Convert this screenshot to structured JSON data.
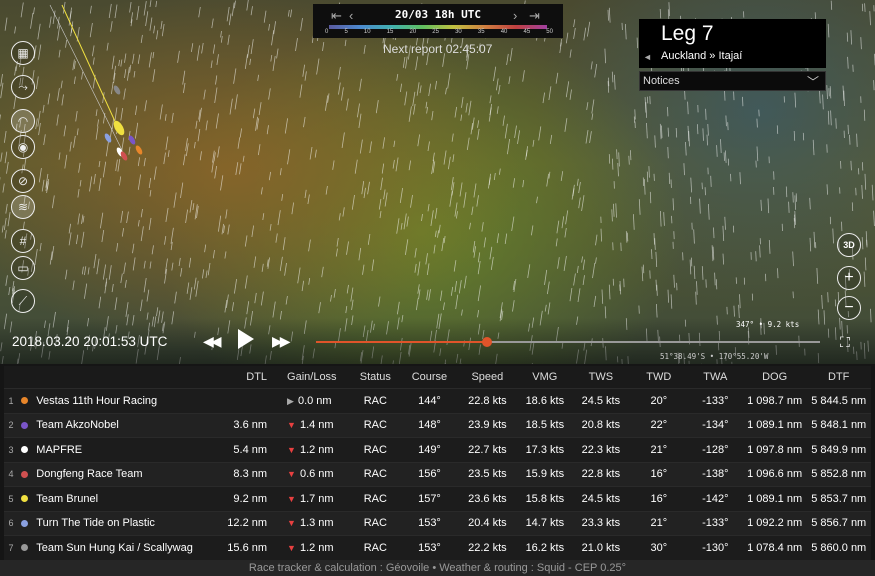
{
  "topbar": {
    "datetime_label": "20/03 18h UTC",
    "prev_icon": "skip-back-icon",
    "next_icon": "skip-forward-icon",
    "scale_ticks": [
      "0",
      "5",
      "10",
      "15",
      "20",
      "25",
      "30",
      "35",
      "40",
      "45",
      "50"
    ]
  },
  "next_report": "Next report 02:45:07",
  "leg": {
    "title": "Leg 7",
    "route": "Auckland » Itajaí"
  },
  "notices": {
    "label": "Notices"
  },
  "tools": [
    {
      "name": "map-icon",
      "glyph": "▦"
    },
    {
      "name": "route-icon",
      "glyph": "⤳"
    },
    {
      "name": "track-icon",
      "glyph": "◠"
    },
    {
      "name": "boat-icon",
      "glyph": "◉"
    },
    {
      "name": "wind-off-icon",
      "glyph": "⊘"
    },
    {
      "name": "wind-icon",
      "glyph": "≋"
    },
    {
      "name": "grid-icon",
      "glyph": "#"
    },
    {
      "name": "ruler-icon",
      "glyph": "▭"
    },
    {
      "name": "chart-icon",
      "glyph": "⟋"
    }
  ],
  "right_controls": {
    "view3d_label": "3D",
    "zoom_in": "+",
    "zoom_out": "−"
  },
  "playback": {
    "datetime": "2018.03.20 20:01:53 UTC",
    "progress": 0.34,
    "wind_info": "347° • 9.2 kts",
    "coordinates": "51°38.49'S • 170°55.20'W"
  },
  "table": {
    "headers": [
      "DTL",
      "Gain/Loss",
      "Status",
      "Course",
      "Speed",
      "VMG",
      "TWS",
      "TWD",
      "TWA",
      "DOG",
      "DTF"
    ],
    "rows": [
      {
        "rank": "1",
        "color": "#e8862a",
        "name": "Vestas 11th Hour Racing",
        "dtl": "",
        "trend": "right",
        "gl": "0.0 nm",
        "status": "RAC",
        "course": "144°",
        "speed": "22.8 kts",
        "vmg": "18.6 kts",
        "tws": "24.5 kts",
        "twd": "20°",
        "twa": "-133°",
        "dog": "1 098.7 nm",
        "dtf": "5 844.5 nm"
      },
      {
        "rank": "2",
        "color": "#7a55c8",
        "name": "Team AkzoNobel",
        "dtl": "3.6 nm",
        "trend": "down",
        "gl": "1.4 nm",
        "status": "RAC",
        "course": "148°",
        "speed": "23.9 kts",
        "vmg": "18.5 kts",
        "tws": "20.8 kts",
        "twd": "22°",
        "twa": "-134°",
        "dog": "1 089.1 nm",
        "dtf": "5 848.1 nm"
      },
      {
        "rank": "3",
        "color": "#ffffff",
        "name": "MAPFRE",
        "dtl": "5.4 nm",
        "trend": "down",
        "gl": "1.2 nm",
        "status": "RAC",
        "course": "149°",
        "speed": "22.7 kts",
        "vmg": "17.3 kts",
        "tws": "22.3 kts",
        "twd": "21°",
        "twa": "-128°",
        "dog": "1 097.8 nm",
        "dtf": "5 849.9 nm"
      },
      {
        "rank": "4",
        "color": "#d05050",
        "name": "Dongfeng Race Team",
        "dtl": "8.3 nm",
        "trend": "down",
        "gl": "0.6 nm",
        "status": "RAC",
        "course": "156°",
        "speed": "23.5 kts",
        "vmg": "15.9 kts",
        "tws": "22.8 kts",
        "twd": "16°",
        "twa": "-138°",
        "dog": "1 096.6 nm",
        "dtf": "5 852.8 nm"
      },
      {
        "rank": "5",
        "color": "#f0e040",
        "name": "Team Brunel",
        "dtl": "9.2 nm",
        "trend": "down",
        "gl": "1.7 nm",
        "status": "RAC",
        "course": "157°",
        "speed": "23.6 kts",
        "vmg": "15.8 kts",
        "tws": "24.5 kts",
        "twd": "16°",
        "twa": "-142°",
        "dog": "1 089.1 nm",
        "dtf": "5 853.7 nm"
      },
      {
        "rank": "6",
        "color": "#8aa0e0",
        "name": "Turn The Tide on Plastic",
        "dtl": "12.2 nm",
        "trend": "down",
        "gl": "1.3 nm",
        "status": "RAC",
        "course": "153°",
        "speed": "20.4 kts",
        "vmg": "14.7 kts",
        "tws": "23.3 kts",
        "twd": "21°",
        "twa": "-133°",
        "dog": "1 092.2 nm",
        "dtf": "5 856.7 nm"
      },
      {
        "rank": "7",
        "color": "#999999",
        "name": "Team Sun Hung Kai / Scallywag",
        "dtl": "15.6 nm",
        "trend": "down",
        "gl": "1.2 nm",
        "status": "RAC",
        "course": "153°",
        "speed": "22.2 kts",
        "vmg": "16.2 kts",
        "tws": "21.0 kts",
        "twd": "30°",
        "twa": "-130°",
        "dog": "1 078.4 nm",
        "dtf": "5 860.0 nm"
      }
    ]
  },
  "footer": "Race tracker & calculation : Géovoile • Weather & routing : Squid - CEP 0.25°"
}
